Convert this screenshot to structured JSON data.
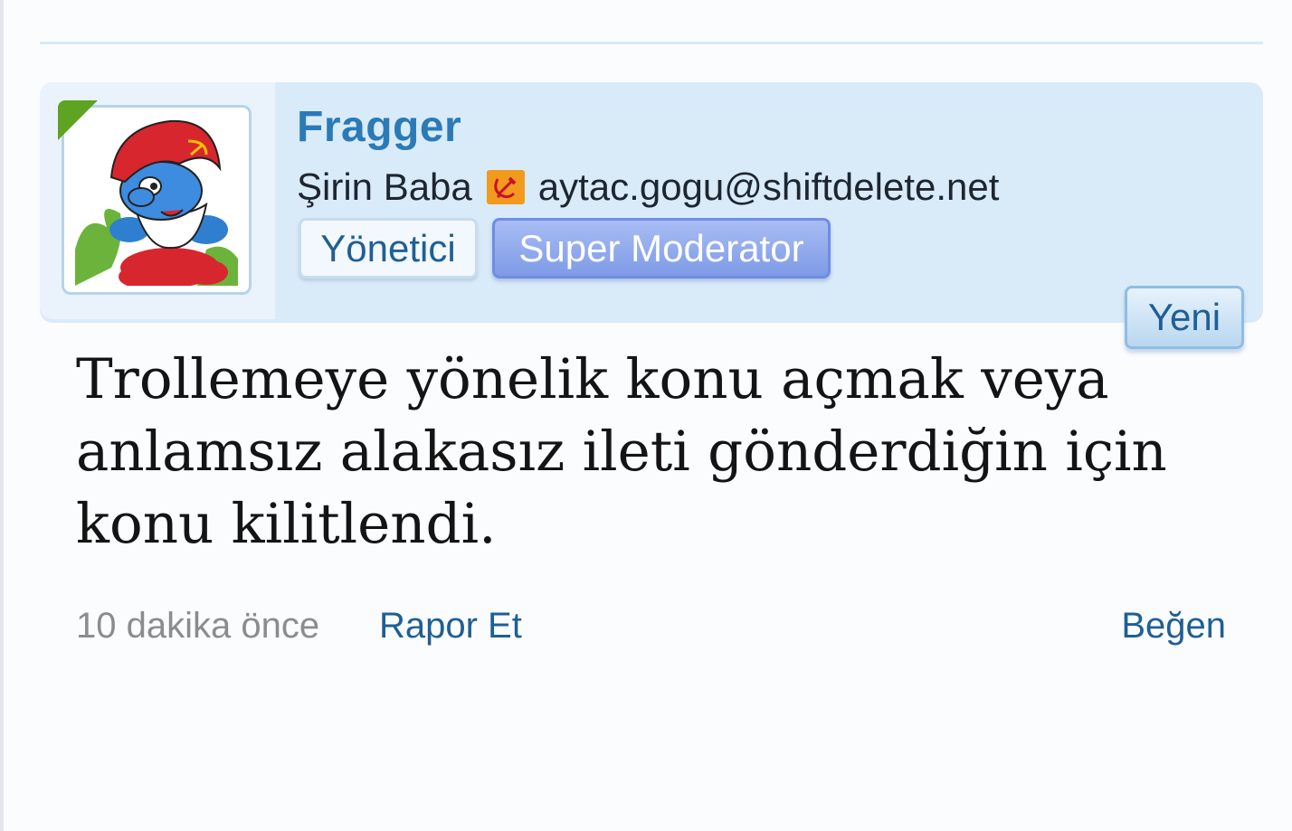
{
  "post": {
    "user": {
      "name": "Fragger",
      "title": "Şirin Baba",
      "flag_icon": "hammer-sickle-icon",
      "email": "aytac.gogu@shiftdelete.net",
      "banners": [
        "Yönetici",
        "Super Moderator"
      ],
      "online": true
    },
    "new_badge": "Yeni",
    "message": "Trollemeye yönelik konu açmak veya anlamsız alakasız ileti gönderdiğin için konu kilitlendi.",
    "footer": {
      "time": "10 dakika önce",
      "report": "Rapor Et",
      "like": "Beğen"
    }
  },
  "colors": {
    "username": "#2b7ab8",
    "header_bg": "#d9ebf9",
    "link": "#1f5f95",
    "online": "#5ea321",
    "supermod_banner": "#7e9be6"
  }
}
